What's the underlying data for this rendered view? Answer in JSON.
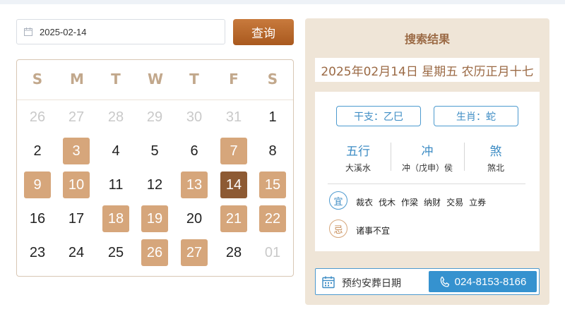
{
  "search": {
    "date_value": "2025-02-14",
    "query_label": "查询"
  },
  "calendar": {
    "weekdays": [
      "S",
      "M",
      "T",
      "W",
      "T",
      "F",
      "S"
    ],
    "days": [
      {
        "d": "26",
        "t": "other"
      },
      {
        "d": "27",
        "t": "other"
      },
      {
        "d": "28",
        "t": "other"
      },
      {
        "d": "29",
        "t": "other"
      },
      {
        "d": "30",
        "t": "other"
      },
      {
        "d": "31",
        "t": "other"
      },
      {
        "d": "1",
        "t": "normal"
      },
      {
        "d": "2",
        "t": "normal"
      },
      {
        "d": "3",
        "t": "hl"
      },
      {
        "d": "4",
        "t": "normal"
      },
      {
        "d": "5",
        "t": "normal"
      },
      {
        "d": "6",
        "t": "normal"
      },
      {
        "d": "7",
        "t": "hl"
      },
      {
        "d": "8",
        "t": "normal"
      },
      {
        "d": "9",
        "t": "hl"
      },
      {
        "d": "10",
        "t": "hl"
      },
      {
        "d": "11",
        "t": "normal"
      },
      {
        "d": "12",
        "t": "normal"
      },
      {
        "d": "13",
        "t": "hl"
      },
      {
        "d": "14",
        "t": "sel"
      },
      {
        "d": "15",
        "t": "hl"
      },
      {
        "d": "16",
        "t": "normal"
      },
      {
        "d": "17",
        "t": "normal"
      },
      {
        "d": "18",
        "t": "hl"
      },
      {
        "d": "19",
        "t": "hl"
      },
      {
        "d": "20",
        "t": "normal"
      },
      {
        "d": "21",
        "t": "hl"
      },
      {
        "d": "22",
        "t": "hl"
      },
      {
        "d": "23",
        "t": "normal"
      },
      {
        "d": "24",
        "t": "normal"
      },
      {
        "d": "25",
        "t": "normal"
      },
      {
        "d": "26",
        "t": "hl"
      },
      {
        "d": "27",
        "t": "hl"
      },
      {
        "d": "28",
        "t": "normal"
      },
      {
        "d": "01",
        "t": "other"
      }
    ]
  },
  "result": {
    "title": "搜索结果",
    "date_line": "2025年02月14日 星期五 农历正月十七",
    "ganzhi": "干支：乙巳",
    "shengxiao": "生肖：蛇",
    "wuxing_head": "五行",
    "wuxing_val": "大溪水",
    "chong_head": "冲",
    "chong_val": "冲（戊申）侯",
    "sha_head": "煞",
    "sha_val": "煞北",
    "yi_label": "宜",
    "yi_items": [
      "裁衣",
      "伐木",
      "作梁",
      "纳财",
      "交易",
      "立券"
    ],
    "ji_label": "忌",
    "ji_items": [
      "诸事不宜"
    ]
  },
  "booking": {
    "label": "预约安葬日期",
    "phone": "024-8153-8166"
  },
  "colors": {
    "accent": "#b2642a",
    "highlight": "#d6a67b",
    "selected": "#8d5a33",
    "blue": "#3592cf",
    "panel": "#efe5d7"
  }
}
